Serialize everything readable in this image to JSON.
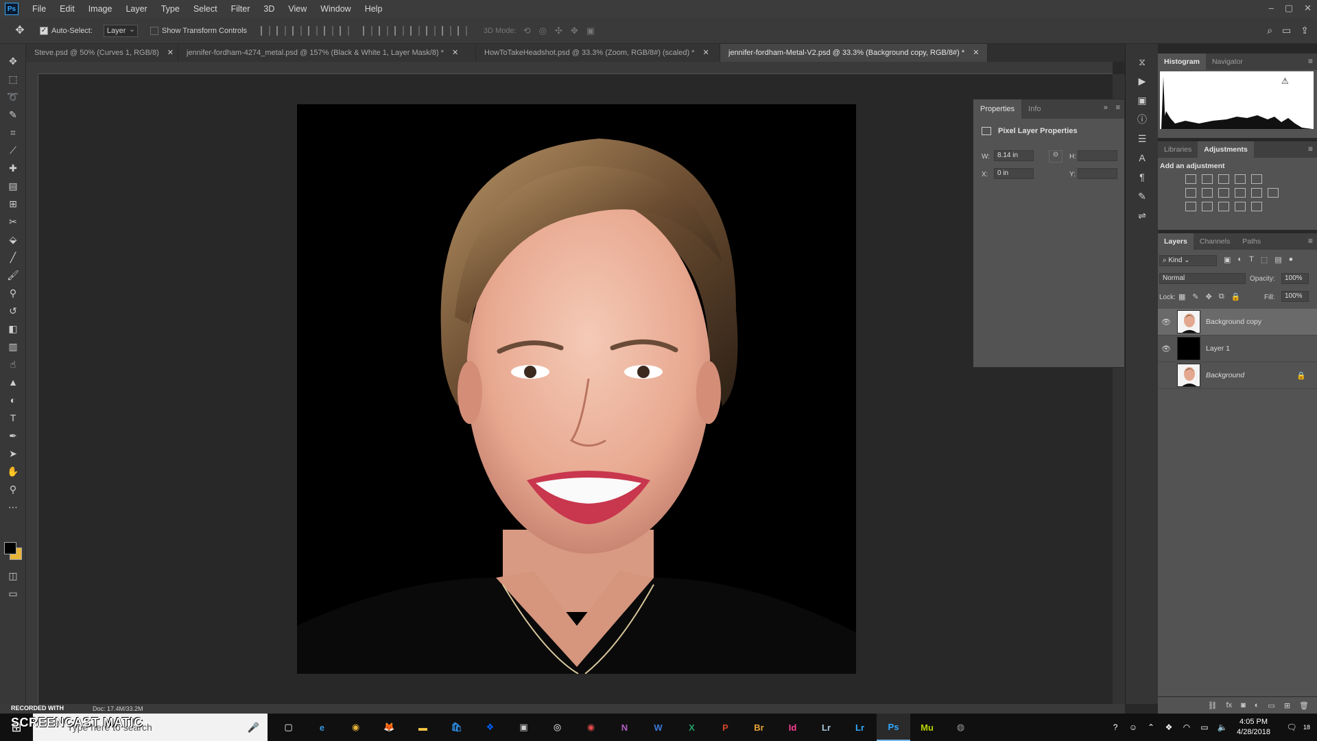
{
  "app": {
    "logo": "Ps"
  },
  "menu": [
    "File",
    "Edit",
    "Image",
    "Layer",
    "Type",
    "Select",
    "Filter",
    "3D",
    "View",
    "Window",
    "Help"
  ],
  "window_controls": [
    "–",
    "▢",
    "✕"
  ],
  "options": {
    "auto_select_label": "Auto-Select:",
    "auto_select_target": "Layer",
    "show_transform_label": "Show Transform Controls",
    "mode_3d": "3D Mode:"
  },
  "tabs": [
    {
      "title": "Steve.psd @ 50% (Curves 1, RGB/8)"
    },
    {
      "title": "jennifer-fordham-4274_metal.psd @ 157% (Black & White 1, Layer Mask/8) *"
    },
    {
      "title": "HowToTakeHeadshot.psd @ 33.3% (Zoom, RGB/8#) (scaled) *"
    },
    {
      "title": "jennifer-fordham-Metal-V2.psd @ 33.3% (Background copy, RGB/8#) *"
    }
  ],
  "properties": {
    "tabs": [
      "Properties",
      "Info"
    ],
    "title": "Pixel Layer Properties",
    "w_label": "W:",
    "w_value": "8.14 in",
    "h_label": "H:",
    "x_label": "X:",
    "x_value": "0 in",
    "y_label": "Y:"
  },
  "histogram_panel": {
    "tabs": [
      "Histogram",
      "Navigator"
    ]
  },
  "adjustments_panel": {
    "tabs": [
      "Libraries",
      "Adjustments"
    ],
    "title": "Add an adjustment"
  },
  "layers_panel": {
    "tabs": [
      "Layers",
      "Channels",
      "Paths"
    ],
    "kind_label": "Kind",
    "blend_mode": "Normal",
    "opacity_label": "Opacity:",
    "opacity_value": "100%",
    "lock_label": "Lock:",
    "fill_label": "Fill:",
    "fill_value": "100%",
    "layers": [
      {
        "name": "Background copy",
        "visible": true,
        "selected": true
      },
      {
        "name": "Layer 1",
        "visible": true,
        "selected": false
      },
      {
        "name": "Background",
        "visible": false,
        "selected": false,
        "locked": true
      }
    ]
  },
  "status": {
    "recorded": "RECORDED WITH",
    "doc": "Doc: 17.4M/33.2M"
  },
  "watermark": "SCREENCAST MATIC",
  "taskbar": {
    "search_placeholder": "Type here to search",
    "apps": [
      {
        "label": "▢",
        "color": "#ffffff"
      },
      {
        "label": "e",
        "color": "#3a96dd"
      },
      {
        "label": "◉",
        "color": "#e8b437"
      },
      {
        "label": "🦊",
        "color": "#ff7139"
      },
      {
        "label": "▬",
        "color": "#f4c542"
      },
      {
        "label": "🛍",
        "color": "#2d8de3"
      },
      {
        "label": "❖",
        "color": "#0061fe"
      },
      {
        "label": "▣",
        "color": "#cfcfcf"
      },
      {
        "label": "◎",
        "color": "#ffffff"
      },
      {
        "label": "◉",
        "color": "#e34b4b"
      },
      {
        "label": "N",
        "color": "#b05ec1"
      },
      {
        "label": "W",
        "color": "#3b79d8"
      },
      {
        "label": "X",
        "color": "#21a366"
      },
      {
        "label": "P",
        "color": "#d24726"
      },
      {
        "label": "Br",
        "color": "#e8a33a"
      },
      {
        "label": "Id",
        "color": "#ff3f94"
      },
      {
        "label": "Lr",
        "color": "#a7c4d9"
      },
      {
        "label": "Lr",
        "color": "#31a8ff"
      },
      {
        "label": "Ps",
        "color": "#31a8ff"
      },
      {
        "label": "Mu",
        "color": "#b7d300"
      },
      {
        "label": "◍",
        "color": "#9a9a9a"
      }
    ],
    "time": "4:05 PM",
    "date": "4/28/2018",
    "notif_count": "18"
  }
}
